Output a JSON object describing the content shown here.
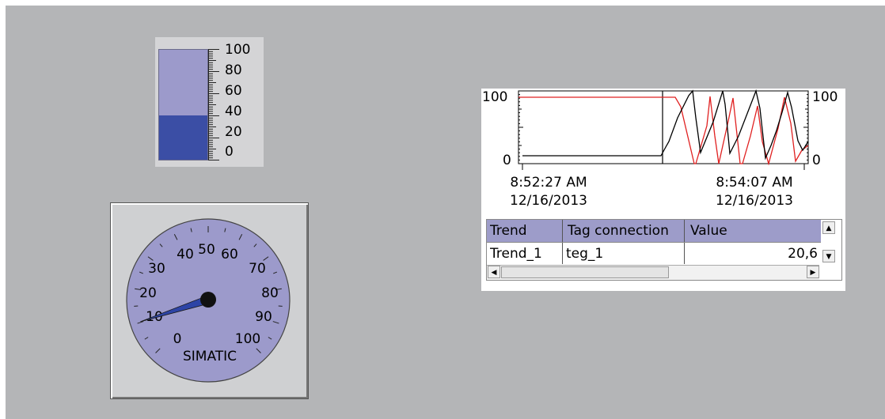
{
  "bar_indicator": {
    "fill_percent": 40,
    "scale_labels": [
      "100",
      "80",
      "60",
      "40",
      "20",
      "0"
    ],
    "colors": {
      "fill": "#3b4ea5",
      "track": "#9c9acb"
    }
  },
  "gauge": {
    "value": 10,
    "labels": [
      "0",
      "10",
      "20",
      "30",
      "40",
      "50",
      "60",
      "70",
      "80",
      "90",
      "100"
    ],
    "brand": "SIMATIC",
    "colors": {
      "dial": "#9c9acb",
      "needle": "#2d44a6"
    }
  },
  "trend": {
    "y_left": {
      "max": "100",
      "min": "0"
    },
    "y_right": {
      "max": "100",
      "min": "0"
    },
    "time_start": {
      "time": "8:52:27 AM",
      "date": "12/16/2013"
    },
    "time_end": {
      "time": "8:54:07 AM",
      "date": "12/16/2013"
    },
    "table": {
      "headers": [
        "Trend",
        "Tag connection",
        "Value"
      ],
      "row": {
        "trend": "Trend_1",
        "tag": "teg_1",
        "value": "20,6"
      }
    },
    "colors": {
      "series_red": "#e02020",
      "series_black": "#000000"
    }
  }
}
